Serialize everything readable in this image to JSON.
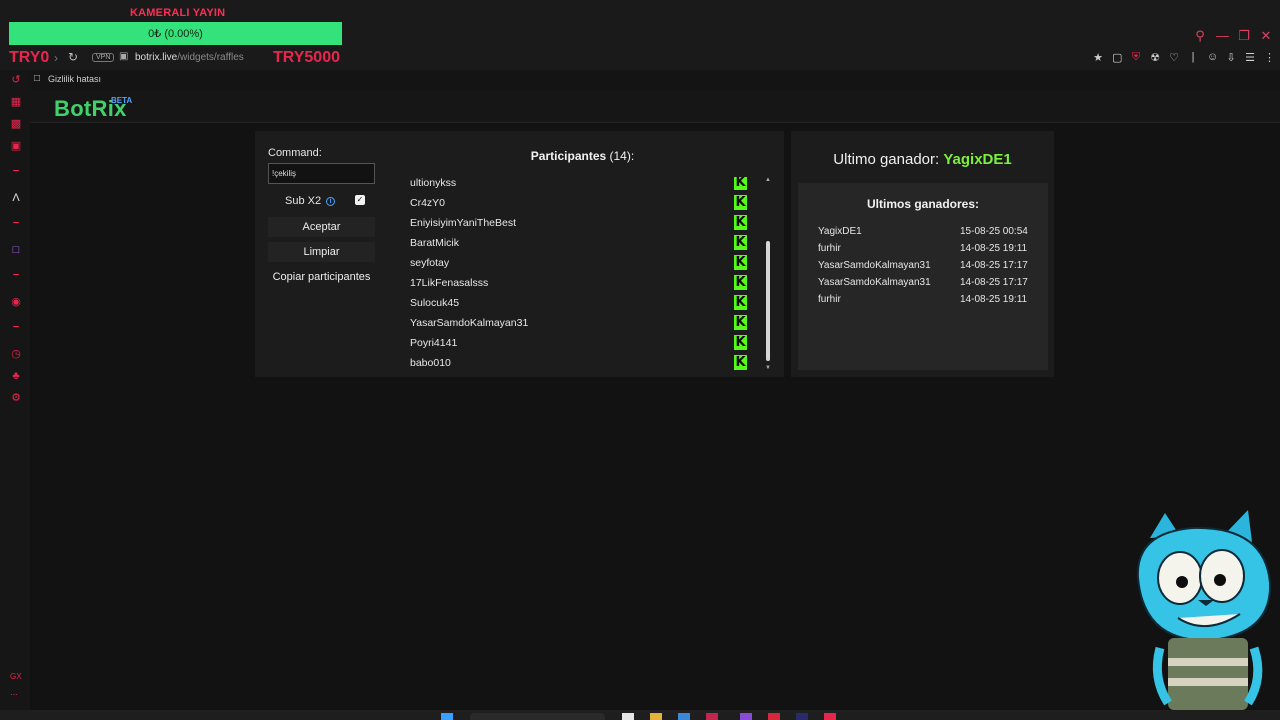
{
  "overlay": {
    "title": "KAMERALI YAYIN",
    "progress_text": "0₺ (0.00%)",
    "bar_color": "#33e27a",
    "goal_start": "TRY0",
    "goal_end": "TRY5000"
  },
  "browser": {
    "vpn_label": "VPN",
    "url_host": "botrix.live",
    "url_path": "/widgets/raffles",
    "bookmark_label": "Gizlilik hatası",
    "accent_color": "#e8264d"
  },
  "site": {
    "logo": "BotRix",
    "beta": "BETA"
  },
  "raffle": {
    "command_label": "Command:",
    "command_value": "!çekiliş",
    "sub_label": "Sub X2",
    "sub_checked": true,
    "accept_label": "Aceptar",
    "clear_label": "Limpiar",
    "copy_label": "Copiar participantes",
    "participants_label": "Participantes",
    "participants_count": "(14):",
    "participants": [
      "ultionykss",
      "Cr4zY0",
      "EniyisiyimYaniTheBest",
      "BaratMicik",
      "seyfotay",
      "17LikFenasalsss",
      "Sulocuk45",
      "YasarSamdoKalmayan31",
      "Poyri4141",
      "babo010"
    ],
    "kick_color": "#53fc18"
  },
  "winners": {
    "last_label": "Ultimo ganador:",
    "last_name": "YagixDE1",
    "list_title": "Ultimos ganadores:",
    "list": [
      {
        "name": "YagixDE1",
        "date": "15-08-25 00:54"
      },
      {
        "name": "furhir",
        "date": "14-08-25 19:11"
      },
      {
        "name": "YasarSamdoKalmayan31",
        "date": "14-08-25 17:17"
      },
      {
        "name": "YasarSamdoKalmayan31",
        "date": "14-08-25 17:17"
      },
      {
        "name": "furhir",
        "date": "14-08-25 19:11"
      }
    ]
  }
}
